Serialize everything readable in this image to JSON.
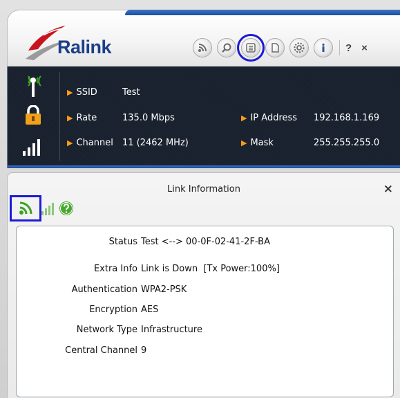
{
  "app": {
    "brand": "Ralink"
  },
  "toolbar": {
    "buttons": [
      {
        "name": "connection",
        "icon": "wifi-signal-icon"
      },
      {
        "name": "profile",
        "icon": "search-icon"
      },
      {
        "name": "link-info",
        "icon": "list-icon",
        "selected": true
      },
      {
        "name": "statistics",
        "icon": "page-icon"
      },
      {
        "name": "settings",
        "icon": "gear-icon"
      },
      {
        "name": "about",
        "icon": "info-icon"
      }
    ],
    "help_label": "?",
    "close_label": "×"
  },
  "status": {
    "ssid_label": "SSID",
    "ssid_value": "Test",
    "rate_label": "Rate",
    "rate_value": "135.0 Mbps",
    "channel_label": "Channel",
    "channel_value": "11 (2462 MHz)",
    "ip_label": "IP Address",
    "ip_value": "192.168.1.169",
    "mask_label": "Mask",
    "mask_value": "255.255.255.0"
  },
  "link_panel": {
    "title": "Link Information",
    "close_label": "×",
    "rows": {
      "status": {
        "label": "Status",
        "value": "Test <--> 00-0F-02-41-2F-BA"
      },
      "extra_info": {
        "label": "Extra Info",
        "value": "Link is Down  [Tx Power:100%]"
      },
      "authentication": {
        "label": "Authentication",
        "value": "WPA2-PSK"
      },
      "encryption": {
        "label": "Encryption",
        "value": "AES"
      },
      "network_type": {
        "label": "Network Type",
        "value": "Infrastructure"
      },
      "central_channel": {
        "label": "Central Channel",
        "value": "9"
      }
    }
  },
  "colors": {
    "brand_blue": "#1b3f8a",
    "panel_dark": "#17202c",
    "arrow_orange": "#ff9a1a",
    "highlight": "#1b1bd6",
    "signal_green": "#3aa322"
  }
}
